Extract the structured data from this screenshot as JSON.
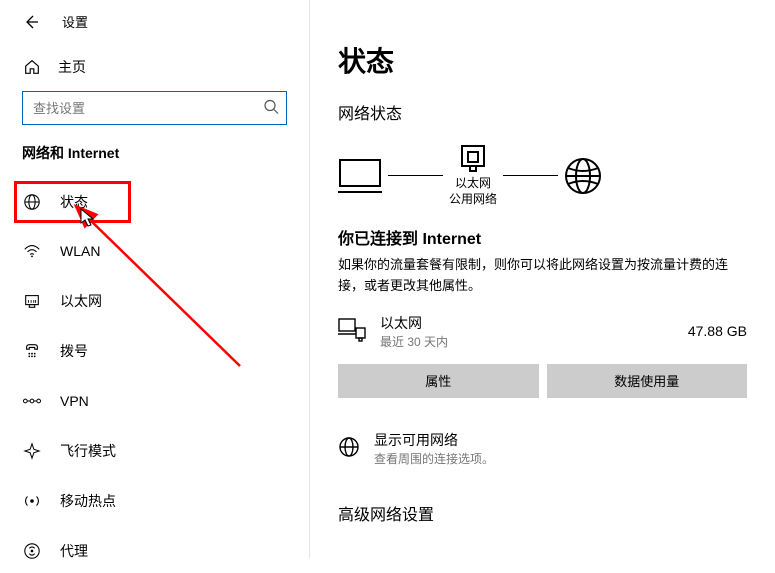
{
  "titlebar": {
    "app_title": "设置"
  },
  "sidebar": {
    "home_label": "主页",
    "search_placeholder": "查找设置",
    "section_label": "网络和 Internet",
    "items": [
      {
        "label": "状态"
      },
      {
        "label": "WLAN"
      },
      {
        "label": "以太网"
      },
      {
        "label": "拨号"
      },
      {
        "label": "VPN"
      },
      {
        "label": "飞行模式"
      },
      {
        "label": "移动热点"
      },
      {
        "label": "代理"
      }
    ]
  },
  "main": {
    "page_title": "状态",
    "subheading": "网络状态",
    "diagram": {
      "adapter_name": "以太网",
      "adapter_type": "公用网络"
    },
    "status_heading": "你已连接到 Internet",
    "status_desc": "如果你的流量套餐有限制，则你可以将此网络设置为按流量计费的连接，或者更改其他属性。",
    "connection": {
      "name": "以太网",
      "period": "最近 30 天内",
      "usage": "47.88 GB"
    },
    "buttons": {
      "properties": "属性",
      "data_usage": "数据使用量"
    },
    "show_networks": {
      "title": "显示可用网络",
      "sub": "查看周围的连接选项。"
    },
    "advanced_heading": "高级网络设置"
  }
}
